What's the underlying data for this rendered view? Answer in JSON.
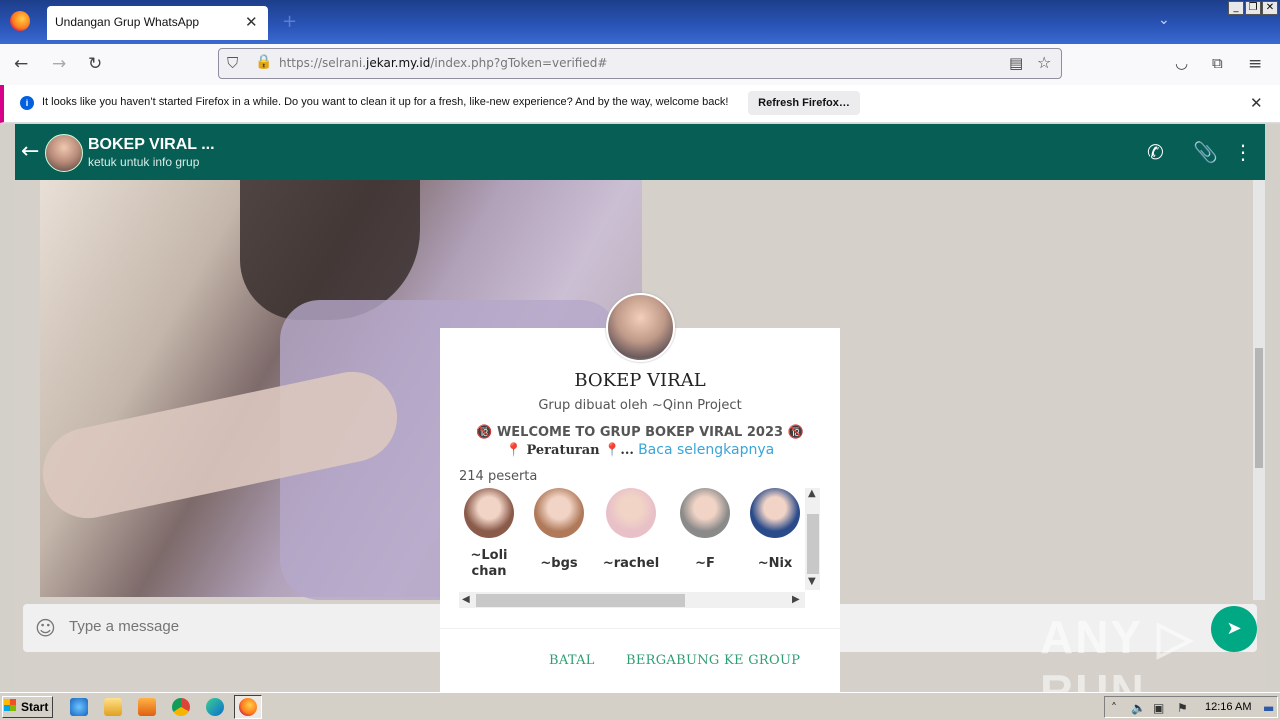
{
  "browser": {
    "tab_title": "Undangan Grup WhatsApp",
    "url_prefix": "https://selrani.",
    "url_domain": "jekar.my.id",
    "url_suffix": "/index.php?gToken=verified#",
    "notification_text": "It looks like you haven’t started Firefox in a while. Do you want to clean it up for a fresh, like-new experience? And by the way, welcome back!",
    "refresh_button": "Refresh Firefox…"
  },
  "whatsapp": {
    "group_name": "BOKEP VIRAL ...",
    "group_subtitle": "ketuk untuk info grup",
    "message_placeholder": "Type a message"
  },
  "modal": {
    "title": "BOKEP VIRAL",
    "creator": "Grup dibuat oleh ~Qinn Project",
    "description_line1": "🔞 WELCOME TO GRUP BOKEP VIRAL 2023 🔞",
    "description_rules": "📍 Peraturan 📍...",
    "read_more": "Baca selengkapnya",
    "participant_count": "214 peserta",
    "members": [
      {
        "name": "~Loli chan",
        "color": "#8a5a4a"
      },
      {
        "name": "~bgs",
        "color": "#b07a5a"
      },
      {
        "name": "~rachel",
        "color": "#e8c0c8"
      },
      {
        "name": "~F",
        "color": "#8a8a8a"
      },
      {
        "name": "~Nix",
        "color": "#2a4a8a"
      }
    ],
    "cancel_button": "BATAL",
    "join_button": "BERGABUNG KE GROUP"
  },
  "watermark": "ANY ▷ RUN",
  "taskbar": {
    "start_label": "Start",
    "clock": "12:16 AM"
  },
  "colors": {
    "whatsapp_header": "#075e54",
    "accent_green": "#2e9e74",
    "link_blue": "#39a5d8"
  }
}
